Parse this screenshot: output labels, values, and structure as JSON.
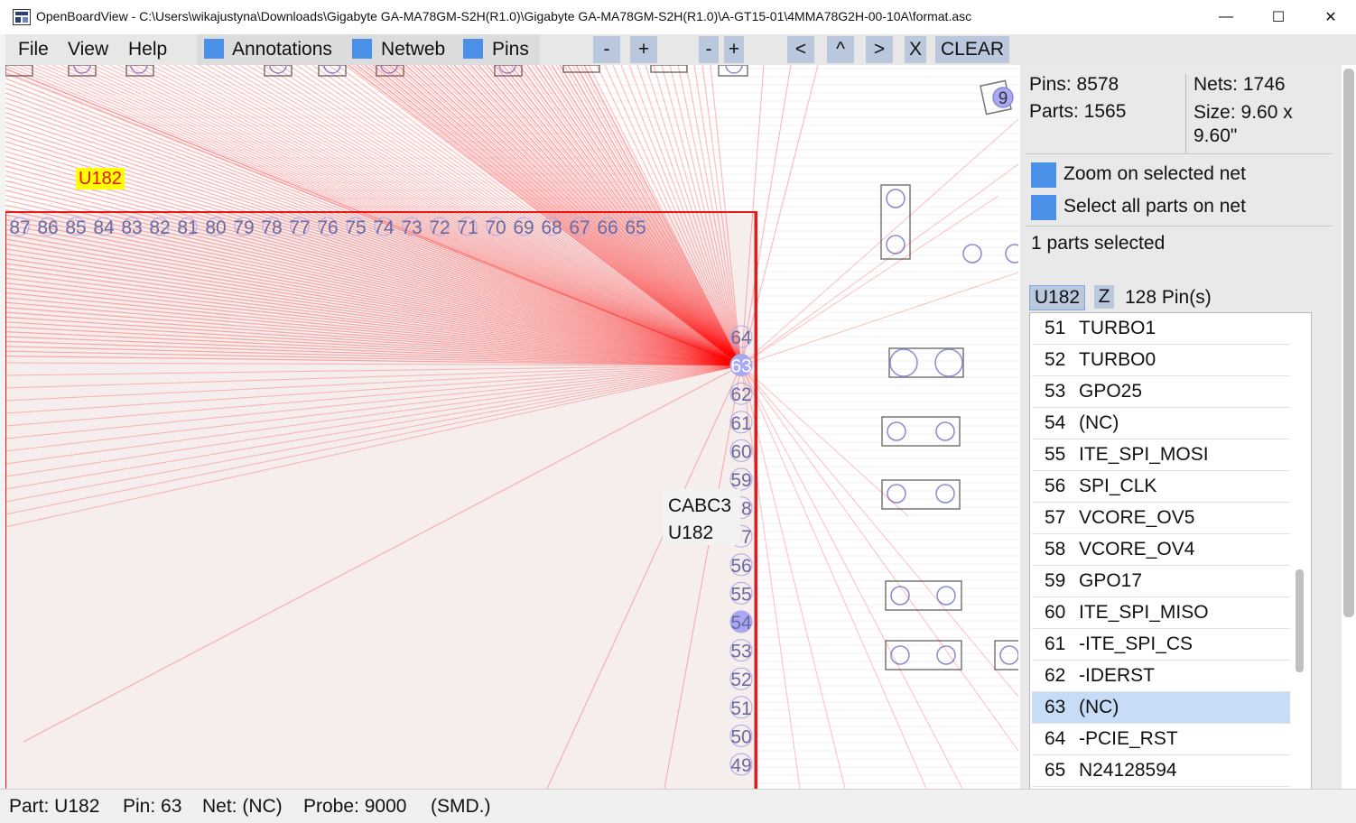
{
  "window": {
    "title": "OpenBoardView - C:\\Users\\wikajustyna\\Downloads\\Gigabyte GA-MA78GM-S2H(R1.0)\\Gigabyte GA-MA78GM-S2H(R1.0)\\A-GT15-01\\4MMA78G2H-00-10A\\format.asc",
    "minimize": "—",
    "maximize": "☐",
    "close": "✕"
  },
  "menu": {
    "file": "File",
    "view": "View",
    "help": "Help",
    "annotations": "Annotations",
    "netweb": "Netweb",
    "pins": "Pins",
    "zoom_minus": "-",
    "zoom_plus": "+",
    "netweb_minus": "-",
    "netweb_plus": "+",
    "prev": "<",
    "up": "^",
    "next": ">",
    "x": "X",
    "clear": "CLEAR"
  },
  "board": {
    "part_label": "U182",
    "top_pins": [
      "87",
      "86",
      "85",
      "84",
      "83",
      "82",
      "81",
      "80",
      "79",
      "78",
      "77",
      "76",
      "75",
      "74",
      "73",
      "72",
      "71",
      "70",
      "69",
      "68",
      "67",
      "66",
      "65"
    ],
    "right_pins": [
      "64",
      "63",
      "62",
      "61",
      "60",
      "59",
      "58",
      "57",
      "56",
      "55",
      "54",
      "53",
      "52",
      "51",
      "50",
      "49"
    ],
    "tooltip_line1": "CABC3",
    "tooltip_line2": "U182",
    "corner_pin": "9"
  },
  "panel": {
    "pins": "Pins: 8578",
    "parts": "Parts: 1565",
    "nets": "Nets: 1746",
    "size": "Size: 9.60 x 9.60\"",
    "zoom_on_net": "Zoom on selected net",
    "select_all_parts": "Select all parts on net",
    "parts_selected": "1 parts selected",
    "part_name": "U182",
    "zoom_button": "Z",
    "pin_count": "128 Pin(s)",
    "pin_list": [
      {
        "num": "51",
        "name": "TURBO1"
      },
      {
        "num": "52",
        "name": "TURBO0"
      },
      {
        "num": "53",
        "name": "GPO25"
      },
      {
        "num": "54",
        "name": "(NC)"
      },
      {
        "num": "55",
        "name": "ITE_SPI_MOSI"
      },
      {
        "num": "56",
        "name": "SPI_CLK"
      },
      {
        "num": "57",
        "name": "VCORE_OV5"
      },
      {
        "num": "58",
        "name": "VCORE_OV4"
      },
      {
        "num": "59",
        "name": "GPO17"
      },
      {
        "num": "60",
        "name": "ITE_SPI_MISO"
      },
      {
        "num": "61",
        "name": "-ITE_SPI_CS"
      },
      {
        "num": "62",
        "name": "-IDERST"
      },
      {
        "num": "63",
        "name": "(NC)"
      },
      {
        "num": "64",
        "name": "-PCIE_RST"
      },
      {
        "num": "65",
        "name": "N24128594"
      }
    ],
    "selected_pin": "63"
  },
  "status": {
    "part": "Part: U182",
    "pin": "Pin: 63",
    "net": "Net: (NC)",
    "probe": "Probe: 9000",
    "type": "(SMD.)"
  },
  "colors": {
    "accent": "#4a90e8",
    "netweb": "#ff0000",
    "part_label_bg": "#ffff00",
    "selected_row": "#c6dcf7"
  }
}
